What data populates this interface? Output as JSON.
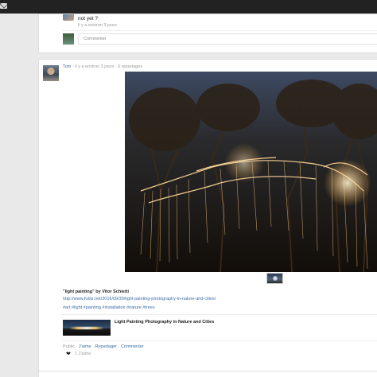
{
  "feed": {
    "post1": {
      "comment_text": "not yet ?",
      "comment_time": "il y a environ 3 jours",
      "comment_placeholder": "Commenter"
    },
    "post2": {
      "author": "Tom",
      "meta": " · il y a environ 3 jours · 6 repartages",
      "title": "\"light painting\" by Vitor Schietti",
      "link": "http://www.fubiz.net/2016/09/30/light-painting-photography-in-nature-and-cities/",
      "tags": "#art #light #painting #installation #nature #trees",
      "share_title": "Light Painting Photography in Nature and Cities",
      "actions": {
        "public": "Public",
        "sep": " · ",
        "like": "J'aime",
        "reshare": "Repartager",
        "comment": "Commenter"
      },
      "like_count": "1 J'aime"
    }
  },
  "icons": {
    "mail": "mail-icon",
    "heart": "heart-icon"
  },
  "colors": {
    "topbar": "#222222",
    "link": "#3a6ea5",
    "background": "#e9e9e9"
  }
}
